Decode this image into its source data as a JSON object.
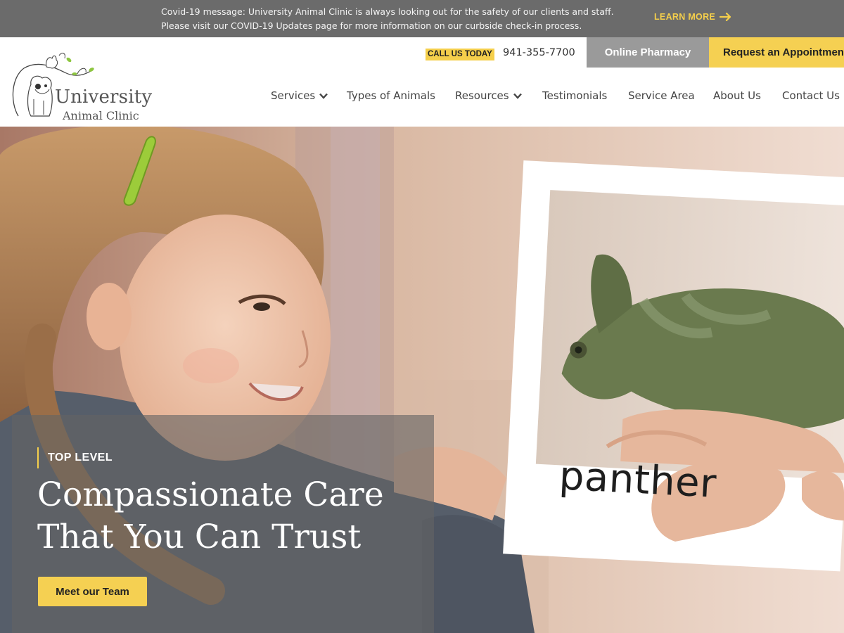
{
  "alert": {
    "line1": "Covid-19 message: University Animal Clinic is always looking out for the safety of our clients and staff.",
    "line2": "Please visit our COVID-19 Updates page for more information on our curbside check-in process.",
    "link_label": "LEARN MORE",
    "link_icon": "arrow-right-icon"
  },
  "header": {
    "logo_line1": "University",
    "logo_line2": "Animal Clinic",
    "call_label": "CALL US TODAY",
    "phone": "941-355-7700",
    "pharmacy_label": "Online Pharmacy",
    "appointment_label": "Request an Appointment"
  },
  "nav": {
    "items": [
      {
        "label": "Services",
        "has_dropdown": true
      },
      {
        "label": "Types of Animals",
        "has_dropdown": false
      },
      {
        "label": "Resources",
        "has_dropdown": true
      },
      {
        "label": "Testimonials",
        "has_dropdown": false
      },
      {
        "label": "Service Area",
        "has_dropdown": false
      },
      {
        "label": "About Us",
        "has_dropdown": false
      },
      {
        "label": "Contact Us",
        "has_dropdown": false
      }
    ]
  },
  "hero": {
    "card_text": "panther",
    "eyebrow": "TOP LEVEL",
    "headline_line1": "Compassionate Care",
    "headline_line2": "That You Can Trust",
    "cta_label": "Meet our Team"
  },
  "colors": {
    "accent_yellow": "#f5d052",
    "alert_bg": "#6b6b6b",
    "pharmacy_bg": "#9a9a9a"
  }
}
